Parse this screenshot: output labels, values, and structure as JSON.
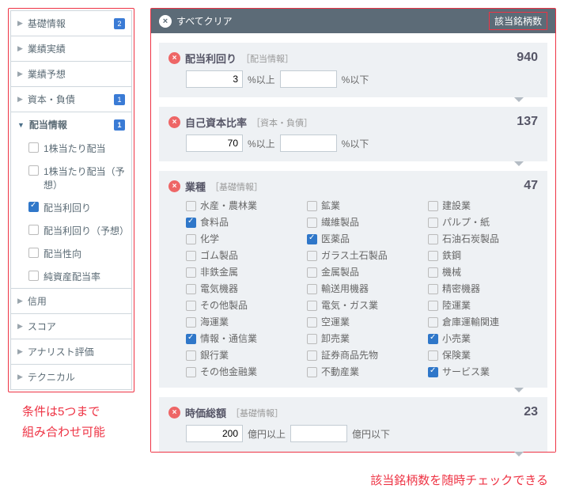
{
  "sidebar": {
    "cats": [
      {
        "label": "基礎情報",
        "badge": "2",
        "open": false
      },
      {
        "label": "業績実績",
        "badge": "",
        "open": false
      },
      {
        "label": "業績予想",
        "badge": "",
        "open": false
      },
      {
        "label": "資本・負債",
        "badge": "1",
        "open": false
      },
      {
        "label": "配当情報",
        "badge": "1",
        "open": true
      },
      {
        "label": "信用",
        "badge": "",
        "open": false
      },
      {
        "label": "スコア",
        "badge": "",
        "open": false
      },
      {
        "label": "アナリスト評価",
        "badge": "",
        "open": false
      },
      {
        "label": "テクニカル",
        "badge": "",
        "open": false
      }
    ],
    "sub": [
      {
        "label": "1株当たり配当",
        "checked": false
      },
      {
        "label": "1株当たり配当（予想）",
        "checked": false
      },
      {
        "label": "配当利回り",
        "checked": true
      },
      {
        "label": "配当利回り（予想）",
        "checked": false
      },
      {
        "label": "配当性向",
        "checked": false
      },
      {
        "label": "純資産配当率",
        "checked": false
      }
    ]
  },
  "annotations": {
    "left1": "条件は5つまで",
    "left2": "組み合わせ可能",
    "bottom": "該当銘柄数を随時チェックできる"
  },
  "topbar": {
    "clear": "すべてクリア",
    "count_head": "該当銘柄数"
  },
  "filters": [
    {
      "title": "配当利回り",
      "group": "［配当情報］",
      "count": "940",
      "type": "range",
      "val": "3",
      "u1": "%以上",
      "u2": "%以下"
    },
    {
      "title": "自己資本比率",
      "group": "［資本・負債］",
      "count": "137",
      "type": "range",
      "val": "70",
      "u1": "%以上",
      "u2": "%以下"
    },
    {
      "title": "業種",
      "group": "［基礎情報］",
      "count": "47",
      "type": "check"
    },
    {
      "title": "時価総額",
      "group": "［基礎情報］",
      "count": "23",
      "type": "range",
      "val": "200",
      "u1": "億円以上",
      "u2": "億円以下"
    }
  ],
  "industries": [
    {
      "l": "水産・農林業",
      "c": false
    },
    {
      "l": "鉱業",
      "c": false
    },
    {
      "l": "建設業",
      "c": false
    },
    {
      "l": "食料品",
      "c": true
    },
    {
      "l": "繊維製品",
      "c": false
    },
    {
      "l": "パルプ・紙",
      "c": false
    },
    {
      "l": "化学",
      "c": false
    },
    {
      "l": "医薬品",
      "c": true
    },
    {
      "l": "石油石炭製品",
      "c": false
    },
    {
      "l": "ゴム製品",
      "c": false
    },
    {
      "l": "ガラス土石製品",
      "c": false
    },
    {
      "l": "鉄鋼",
      "c": false
    },
    {
      "l": "非鉄金属",
      "c": false
    },
    {
      "l": "金属製品",
      "c": false
    },
    {
      "l": "機械",
      "c": false
    },
    {
      "l": "電気機器",
      "c": false
    },
    {
      "l": "輸送用機器",
      "c": false
    },
    {
      "l": "精密機器",
      "c": false
    },
    {
      "l": "その他製品",
      "c": false
    },
    {
      "l": "電気・ガス業",
      "c": false
    },
    {
      "l": "陸運業",
      "c": false
    },
    {
      "l": "海運業",
      "c": false
    },
    {
      "l": "空運業",
      "c": false
    },
    {
      "l": "倉庫運輸関連",
      "c": false
    },
    {
      "l": "情報・通信業",
      "c": true
    },
    {
      "l": "卸売業",
      "c": false
    },
    {
      "l": "小売業",
      "c": true
    },
    {
      "l": "銀行業",
      "c": false
    },
    {
      "l": "証券商品先物",
      "c": false
    },
    {
      "l": "保険業",
      "c": false
    },
    {
      "l": "その他金融業",
      "c": false
    },
    {
      "l": "不動産業",
      "c": false
    },
    {
      "l": "サービス業",
      "c": true
    }
  ]
}
